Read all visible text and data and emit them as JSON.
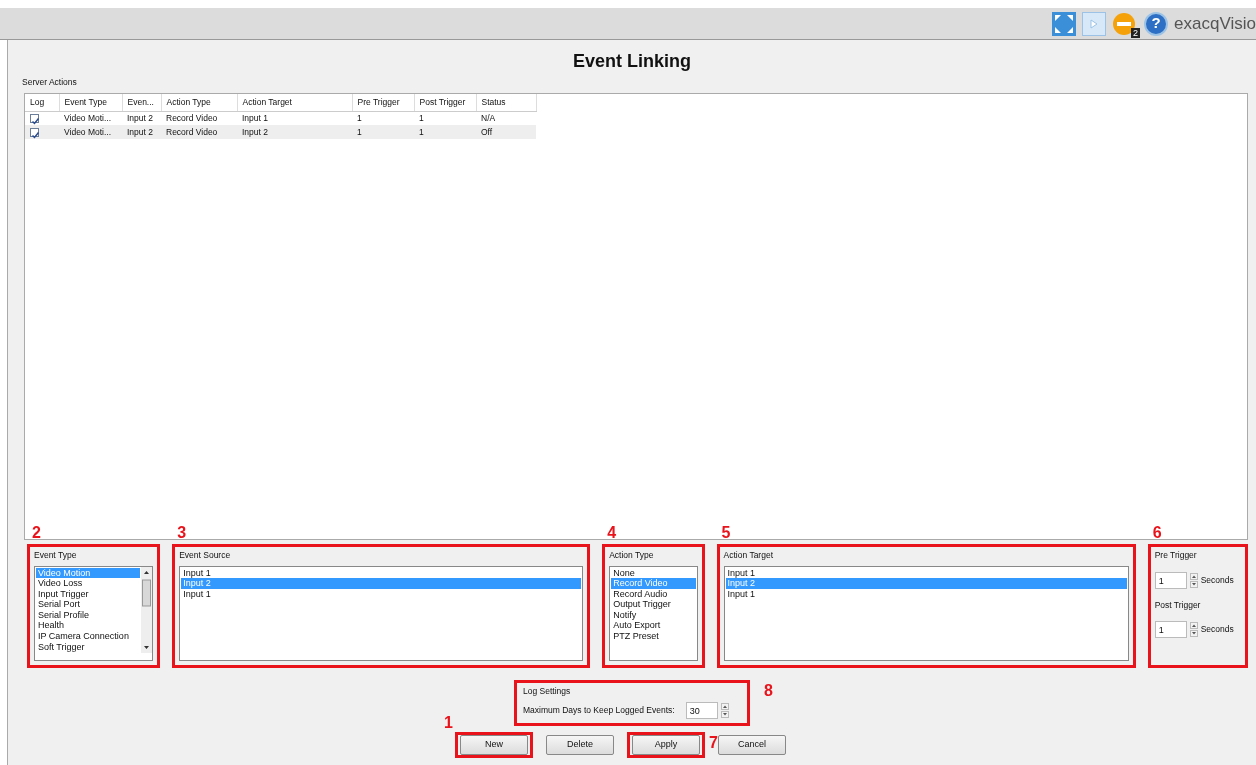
{
  "toolbar": {
    "alert_count": "2",
    "help_glyph": "?",
    "brand": "exacqVisio"
  },
  "title": "Event Linking",
  "server_actions": {
    "label": "Server Actions",
    "log_header": "Log",
    "columns": [
      "Event Type",
      "Even...",
      "Action Type",
      "Action Target",
      "Pre Trigger",
      "Post Trigger",
      "Status"
    ],
    "rows": [
      {
        "log": true,
        "cells": [
          "Video Moti...",
          "Input 2",
          "Record Video",
          "Input 1",
          "1",
          "1",
          "N/A"
        ]
      },
      {
        "log": true,
        "cells": [
          "Video Moti...",
          "Input 2",
          "Record Video",
          "Input 2",
          "1",
          "1",
          "Off"
        ]
      }
    ]
  },
  "panels": [
    {
      "kind": "list",
      "label": "Event Type",
      "callout": "2",
      "scrollbar": true,
      "items": [
        {
          "text": "Video Motion",
          "selected": true
        },
        {
          "text": "Video Loss",
          "selected": false
        },
        {
          "text": "Input Trigger",
          "selected": false
        },
        {
          "text": "Serial Port",
          "selected": false
        },
        {
          "text": "Serial Profile",
          "selected": false
        },
        {
          "text": "Health",
          "selected": false
        },
        {
          "text": "IP Camera Connection",
          "selected": false
        },
        {
          "text": "Soft Trigger",
          "selected": false
        }
      ]
    },
    {
      "kind": "list",
      "label": "Event Source",
      "callout": "3",
      "scrollbar": false,
      "items": [
        {
          "text": "Input 1",
          "selected": false
        },
        {
          "text": "Input 2",
          "selected": true
        },
        {
          "text": "Input 1",
          "selected": false
        }
      ]
    },
    {
      "kind": "list",
      "label": "Action Type",
      "callout": "4",
      "scrollbar": false,
      "items": [
        {
          "text": "None",
          "selected": false
        },
        {
          "text": "Record Video",
          "selected": true
        },
        {
          "text": "Record Audio",
          "selected": false
        },
        {
          "text": "Output Trigger",
          "selected": false
        },
        {
          "text": "Notify",
          "selected": false
        },
        {
          "text": "Auto Export",
          "selected": false
        },
        {
          "text": "PTZ Preset",
          "selected": false
        }
      ]
    },
    {
      "kind": "list",
      "label": "Action Target",
      "callout": "5",
      "scrollbar": false,
      "items": [
        {
          "text": "Input 1",
          "selected": false
        },
        {
          "text": "Input 2",
          "selected": true
        },
        {
          "text": "Input 1",
          "selected": false
        }
      ]
    },
    {
      "kind": "spinners",
      "callout": "6",
      "groups": [
        {
          "label": "Pre Trigger",
          "value": "1",
          "unit": "Seconds"
        },
        {
          "label": "Post Trigger",
          "value": "1",
          "unit": "Seconds"
        }
      ]
    }
  ],
  "log_settings": {
    "label": "Log Settings",
    "field_label": "Maximum Days to Keep Logged Events:",
    "value": "30",
    "callout": "8"
  },
  "buttons": [
    {
      "label": "New",
      "callout": "1"
    },
    {
      "label": "Delete"
    },
    {
      "label": "Apply",
      "callout": "7"
    },
    {
      "label": "Cancel"
    }
  ]
}
